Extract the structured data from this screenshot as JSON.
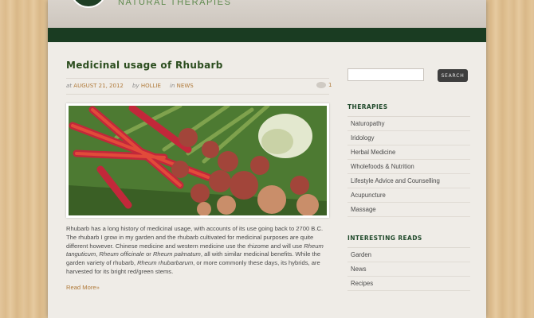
{
  "header": {
    "logo_text": "NATURAL THERAPIES"
  },
  "post": {
    "title": "Medicinal usage of Rhubarb",
    "meta": {
      "at_label": "at",
      "date": "AUGUST 21, 2012",
      "by_label": "by",
      "author": "HOLLIE",
      "in_label": "in",
      "category": "NEWS",
      "comment_count": "1"
    },
    "excerpt": {
      "p1": "Rhubarb has a long history of medicinal usage, with accounts of its use going back to 2700 B.C. The rhubarb I grow in my garden and the rhubarb cultivated for medicinal purposes are quite different however. Chinese medicine and western medicine use the rhizome and will use ",
      "sp1": "Rheum tanguticum",
      "p2": ", ",
      "sp2": "Rheum officinale",
      "p3": " or ",
      "sp3": "Rheum palmatum",
      "p4": ", all with similar medicinal benefits. While the garden variety of rhubarb, ",
      "sp4": "Rheum rhubarbarum",
      "p5": ", or more commonly these days, its hybrids, are harvested for its bright red/green stems."
    },
    "read_more": "Read More»"
  },
  "sidebar": {
    "search": {
      "placeholder": "",
      "button_label": "SEARCH"
    },
    "therapies": {
      "heading": "THERAPIES",
      "items": [
        "Naturopathy",
        "Iridology",
        "Herbal Medicine",
        "Wholefoods & Nutrition",
        "Lifestyle Advice and Counselling",
        "Acupuncture",
        "Massage"
      ]
    },
    "interesting_reads": {
      "heading": "INTERESTING READS",
      "items": [
        "Garden",
        "News",
        "Recipes"
      ]
    }
  },
  "colors": {
    "nav_bar": "#1a3c22",
    "heading_green": "#214a2c",
    "link_orange": "#b07a3a",
    "search_button": "#3e3e3e"
  },
  "icons": {
    "comments": "comment-bubble-icon",
    "logo": "leaf-logo-icon"
  }
}
